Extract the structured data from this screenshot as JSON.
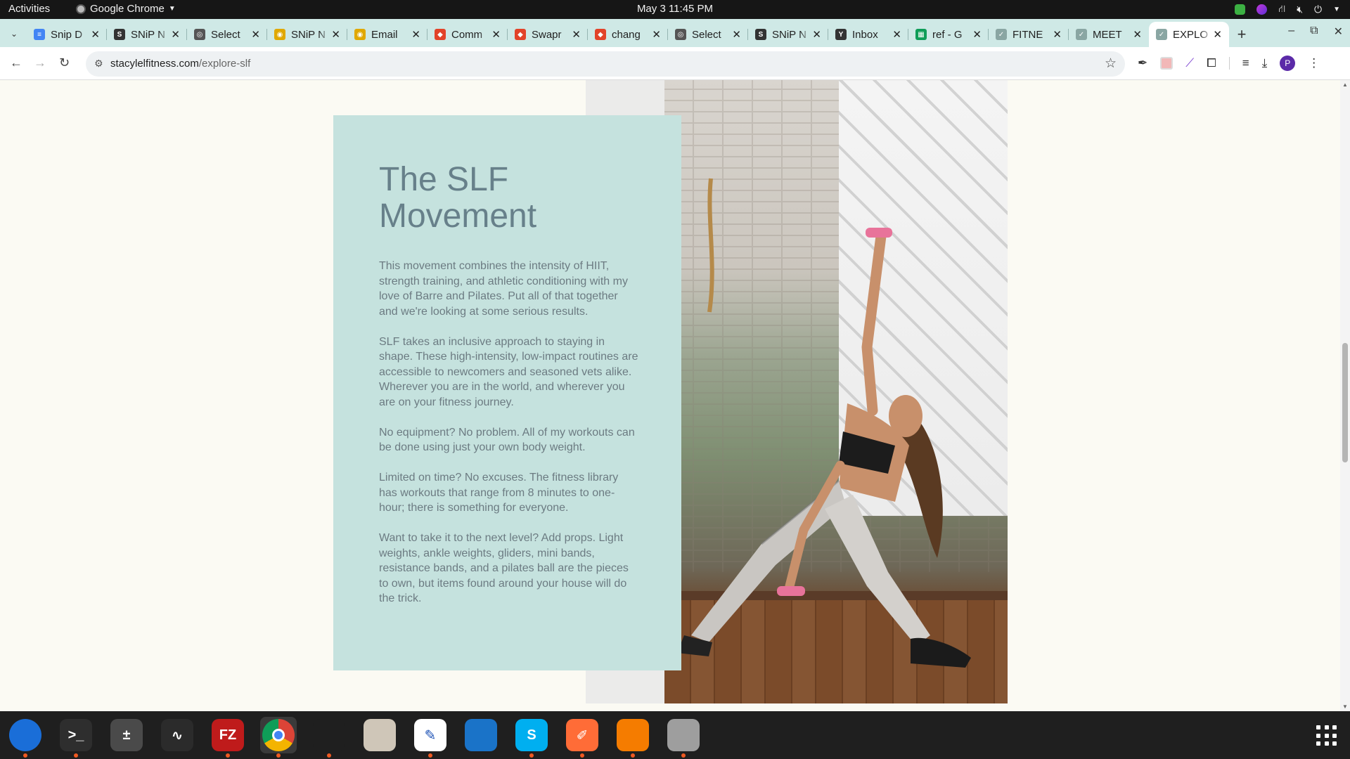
{
  "system": {
    "activities": "Activities",
    "app_name": "Google Chrome",
    "clock": "May 3  11:45 PM"
  },
  "tabs": [
    {
      "title": "Snip D",
      "icon": "docs-icon",
      "color": "#4285f4"
    },
    {
      "title": "SNiP N",
      "icon": "snip-icon",
      "color": "#333333"
    },
    {
      "title": "Select",
      "icon": "globe-icon",
      "color": "#555555"
    },
    {
      "title": "SNiP N",
      "icon": "chrome-icon",
      "color": "#e0a800"
    },
    {
      "title": "Email",
      "icon": "chrome-icon",
      "color": "#e0a800"
    },
    {
      "title": "Comm",
      "icon": "gitlab-icon",
      "color": "#e24329"
    },
    {
      "title": "Swapr",
      "icon": "gitlab-icon",
      "color": "#e24329"
    },
    {
      "title": "chang",
      "icon": "gitlab-icon",
      "color": "#e24329"
    },
    {
      "title": "Select",
      "icon": "globe-icon",
      "color": "#555555"
    },
    {
      "title": "SNiP N",
      "icon": "snip-icon",
      "color": "#333333"
    },
    {
      "title": "Inbox",
      "icon": "yahoo-icon",
      "color": "#333333"
    },
    {
      "title": "ref - G",
      "icon": "sheets-icon",
      "color": "#0f9d58"
    },
    {
      "title": "FITNE",
      "icon": "slf-icon",
      "color": "#8aa6a3"
    },
    {
      "title": "MEET",
      "icon": "slf-icon",
      "color": "#8aa6a3"
    },
    {
      "title": "EXPLO",
      "icon": "slf-icon",
      "color": "#8aa6a3"
    }
  ],
  "toolbar": {
    "url_domain": "stacylelfitness.com",
    "url_path": "/explore-slf"
  },
  "content": {
    "heading": "The SLF Movement",
    "paragraphs": [
      "This movement combines the intensity of HIIT, strength training, and athletic conditioning with my love of Barre and Pilates. Put all of that together and we're looking at some serious results.",
      "SLF takes an inclusive approach to staying in shape. These high-intensity, low-impact routines are accessible to newcomers and seasoned vets alike. Wherever you are in the world, and wherever you are on your fitness journey.",
      "No equipment? No problem. All of my workouts can be done using just your own body weight.",
      "Limited on time? No excuses. The fitness library has workouts that range from 8 minutes to one-hour; there is something for everyone.",
      "Want to take it to the next level? Add props. Light weights, ankle weights, gliders, mini bands, resistance bands, and a pilates ball are the pieces to own, but items found around your house will do the trick."
    ]
  },
  "dock": [
    {
      "name": "thunderbird-icon",
      "label": "",
      "color": "#1a6ed8",
      "running": true
    },
    {
      "name": "terminal-icon",
      "label": ">_",
      "color": "#2e2e2e",
      "running": true
    },
    {
      "name": "calculator-icon",
      "label": "±",
      "color": "#4a4a4a",
      "running": false
    },
    {
      "name": "system-monitor-icon",
      "label": "∿",
      "color": "#2b2b2b",
      "running": false
    },
    {
      "name": "filezilla-icon",
      "label": "FZ",
      "color": "#bf1b1b",
      "running": true
    },
    {
      "name": "chrome-icon",
      "label": "",
      "color": "#f2f2f2",
      "running": true
    },
    {
      "name": "vscode-icon",
      "label": "",
      "color": "#1f1f1f",
      "running": true
    },
    {
      "name": "files-icon",
      "label": "",
      "color": "#cfc6b8",
      "running": false
    },
    {
      "name": "text-editor-icon",
      "label": "✎",
      "color": "#ffffff",
      "running": true
    },
    {
      "name": "writer-icon",
      "label": "",
      "color": "#1a73c8",
      "running": false
    },
    {
      "name": "skype-icon",
      "label": "S",
      "color": "#00aff0",
      "running": true
    },
    {
      "name": "postman-icon",
      "label": "✐",
      "color": "#ff6c37",
      "running": true
    },
    {
      "name": "burner-icon",
      "label": "",
      "color": "#f57c00",
      "running": true
    },
    {
      "name": "disk-icon",
      "label": "",
      "color": "#9e9e9e",
      "running": true
    }
  ],
  "colors": {
    "card_bg": "#c5e2de",
    "heading": "#67808a",
    "body_text": "#6c7b82",
    "page_bg": "#fbfaf3",
    "tabstrip_bg": "#cfe9e6"
  }
}
